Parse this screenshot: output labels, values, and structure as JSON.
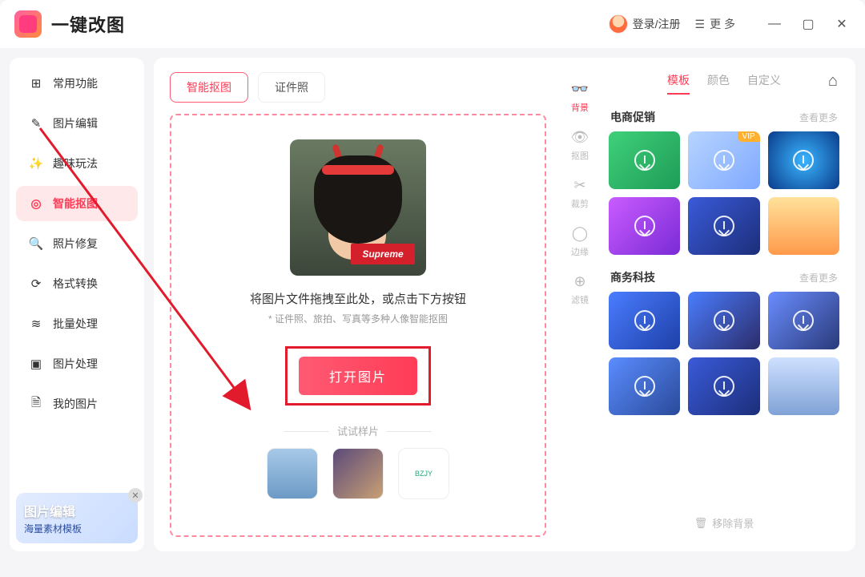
{
  "titlebar": {
    "app_name": "一键改图",
    "login": "登录/注册",
    "more": "更 多"
  },
  "sidebar": {
    "items": [
      {
        "label": "常用功能",
        "icon": "⊞"
      },
      {
        "label": "图片编辑",
        "icon": "✎"
      },
      {
        "label": "趣味玩法",
        "icon": "✨"
      },
      {
        "label": "智能抠图",
        "icon": "◎",
        "active": true
      },
      {
        "label": "照片修复",
        "icon": "🔍"
      },
      {
        "label": "格式转换",
        "icon": "⟳"
      },
      {
        "label": "批量处理",
        "icon": "≋"
      },
      {
        "label": "图片处理",
        "icon": "▣"
      },
      {
        "label": "我的图片",
        "icon": "🗎"
      }
    ],
    "promo": {
      "title": "图片编辑",
      "sub": "海量素材模板"
    }
  },
  "content_tabs": {
    "tab1": "智能抠图",
    "tab2": "证件照"
  },
  "dropzone": {
    "text": "将图片文件拖拽至此处，或点击下方按钮",
    "sub": "* 证件照、旅拍、写真等多种人像智能抠图",
    "open": "打开图片",
    "try": "试试样片",
    "supreme": "Supreme"
  },
  "right": {
    "vtabs": [
      {
        "label": "背景",
        "active": true
      },
      {
        "label": "抠图"
      },
      {
        "label": "裁剪"
      },
      {
        "label": "边缘"
      },
      {
        "label": "滤镜"
      }
    ],
    "ptabs": {
      "t1": "模板",
      "t2": "颜色",
      "t3": "自定义"
    },
    "sec1": {
      "title": "电商促销",
      "more": "查看更多",
      "vip": "VIP"
    },
    "sec2": {
      "title": "商务科技",
      "more": "查看更多"
    },
    "remove": "移除背景"
  }
}
